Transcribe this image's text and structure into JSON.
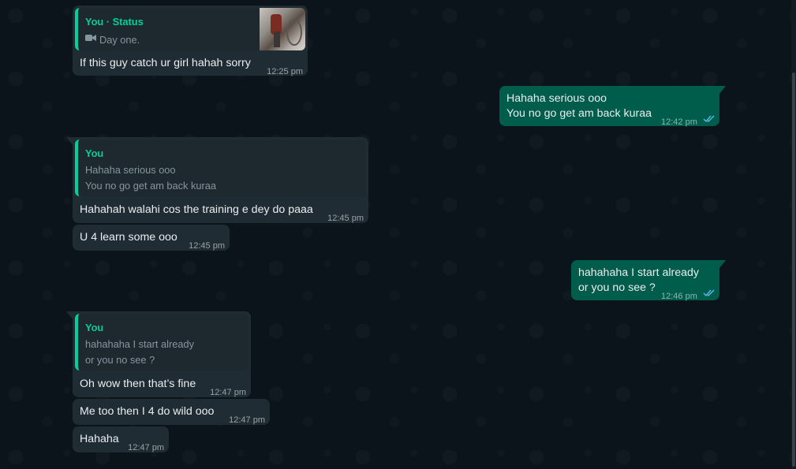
{
  "messages": [
    {
      "direction": "incoming",
      "quote": {
        "author": "You · Status",
        "media_label": "Day one.",
        "media_icon": "video-camera-icon"
      },
      "text": "If this guy catch ur girl hahah sorry",
      "time": "12:25 pm"
    },
    {
      "direction": "outgoing",
      "text_lines": [
        "Hahaha serious ooo",
        "You no go get am back kuraa"
      ],
      "time": "12:42 pm",
      "status": "read-double-tick-icon"
    },
    {
      "direction": "incoming",
      "quote": {
        "author": "You",
        "lines": [
          "Hahaha serious ooo",
          "You no go get am back kuraa"
        ]
      },
      "text": "Hahahah walahi cos the training e dey do paaa",
      "time": "12:45 pm"
    },
    {
      "direction": "incoming",
      "text": "U 4 learn some ooo",
      "time": "12:45 pm"
    },
    {
      "direction": "outgoing",
      "text_lines": [
        "hahahaha I start already",
        "or you no see ?"
      ],
      "time": "12:46 pm",
      "status": "read-double-tick-icon"
    },
    {
      "direction": "incoming",
      "quote": {
        "author": "You",
        "lines": [
          "hahahaha I start already",
          "or you no see ?"
        ]
      },
      "text": "Oh wow then that’s fine",
      "time": "12:47 pm"
    },
    {
      "direction": "incoming",
      "text": "Me too then I 4 do wild ooo",
      "time": "12:47 pm"
    },
    {
      "direction": "incoming",
      "text": "Hahaha",
      "time": "12:47 pm"
    }
  ],
  "colors": {
    "background": "#0b141a",
    "incoming_bubble": "#202c33",
    "outgoing_bubble": "#005c4b",
    "quote_accent": "#06cf9c",
    "read_ticks": "#53bdeb"
  }
}
